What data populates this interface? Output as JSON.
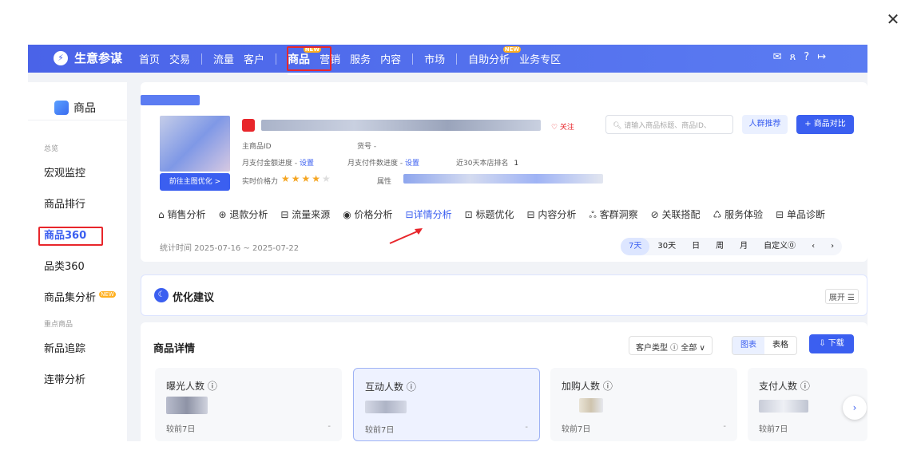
{
  "close": "✕",
  "brand": {
    "logo": "⚡",
    "name": "生意参谋"
  },
  "nav": {
    "home": "首页",
    "trade": "交易",
    "traffic": "流量",
    "customer": "客户",
    "product": "商品",
    "product_badge": "NEW",
    "marketing": "营销",
    "service": "服务",
    "content": "内容",
    "market": "市场",
    "self_analysis": "自助分析",
    "self_badge": "NEW",
    "biz_zone": "业务专区"
  },
  "top_icons": [
    "mail-icon",
    "user-icon",
    "help-icon",
    "logout-icon"
  ],
  "sidebar": {
    "header": "商品",
    "group1": "总览",
    "items1": [
      "宏观监控",
      "商品排行",
      "商品360",
      "品类360",
      "商品集分析"
    ],
    "new_badge": "NEW",
    "group2": "重点商品",
    "items2": [
      "新品追踪",
      "连带分析"
    ]
  },
  "product": {
    "main_id_label": "主商品ID",
    "item_no_label": "货号 -",
    "progress_amount": "月支付金额进度 -",
    "progress_count": "月支付件数进度 -",
    "set": "设置",
    "rank_label": "近30天本店排名",
    "rank_value": "1",
    "price_power": "实时价格力",
    "attr": "属性",
    "follow": "♡ 关注",
    "goto_btn": "前往主图优化 >",
    "rating": 4
  },
  "search": {
    "placeholder": "请输入商品标题、商品ID、"
  },
  "buttons": {
    "crowd": "人群推荐",
    "compare": "+ 商品对比"
  },
  "tabs": [
    "销售分析",
    "退款分析",
    "流量来源",
    "价格分析",
    "详情分析",
    "标题优化",
    "内容分析",
    "客群洞察",
    "关联搭配",
    "服务体验",
    "单品诊断"
  ],
  "active_tab": "详情分析",
  "date": "统计时间 2025-07-16 ~ 2025-07-22",
  "periods": [
    "7天",
    "30天",
    "日",
    "周",
    "月",
    "自定义⓪"
  ],
  "opt": {
    "title": "优化建议",
    "expand": "展开 ☰"
  },
  "detail": {
    "title": "商品详情",
    "customer_type": "客户类型 ⓘ  全部 ∨",
    "view_chart": "图表",
    "view_table": "表格",
    "download": "⇩ 下载",
    "metrics": [
      {
        "label": "曝光人数 ⓘ",
        "comp": "较前7日",
        "dash": "-"
      },
      {
        "label": "互动人数 ⓘ",
        "comp": "较前7日",
        "dash": "-"
      },
      {
        "label": "加购人数 ⓘ",
        "comp": "较前7日",
        "dash": "-"
      },
      {
        "label": "支付人数 ⓘ",
        "comp": "较前7日",
        "dash": "-"
      }
    ]
  },
  "colors": {
    "accent": "#3b5ff0",
    "highlight": "#e8262b",
    "topbar": "#4a63e8"
  }
}
